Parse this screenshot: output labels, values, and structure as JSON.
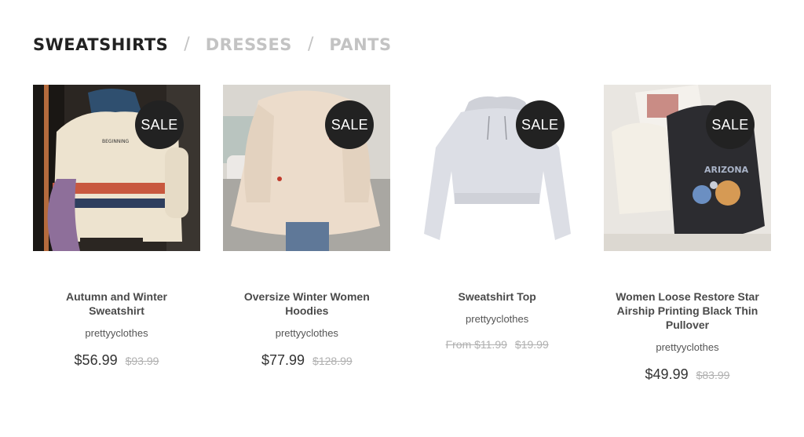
{
  "tabs": [
    {
      "label": "SWEATSHIRTS",
      "active": true
    },
    {
      "label": "DRESSES",
      "active": false
    },
    {
      "label": "PANTS",
      "active": false
    }
  ],
  "separator": "/",
  "products": [
    {
      "title": "Autumn and Winter Sweatshirt",
      "vendor": "prettyyclothes",
      "price": "$56.99",
      "compare_price": "$93.99",
      "badge": "SALE",
      "image": "cream-striped-sweatshirt"
    },
    {
      "title": "Oversize Winter Women Hoodies",
      "vendor": "prettyyclothes",
      "price": "$77.99",
      "compare_price": "$128.99",
      "badge": "SALE",
      "image": "beige-oversize-hoodie"
    },
    {
      "title": "Sweatshirt Top",
      "vendor": "prettyyclothes",
      "price": "From $11.99",
      "compare_price": "$19.99",
      "badge": "SALE",
      "image": "grey-cropped-hoodie"
    },
    {
      "title": "Women Loose Restore Star Airship Printing Black Thin Pullover",
      "vendor": "prettyyclothes",
      "price": "$49.99",
      "compare_price": "$83.99",
      "badge": "SALE",
      "image": "black-print-pullover"
    }
  ]
}
